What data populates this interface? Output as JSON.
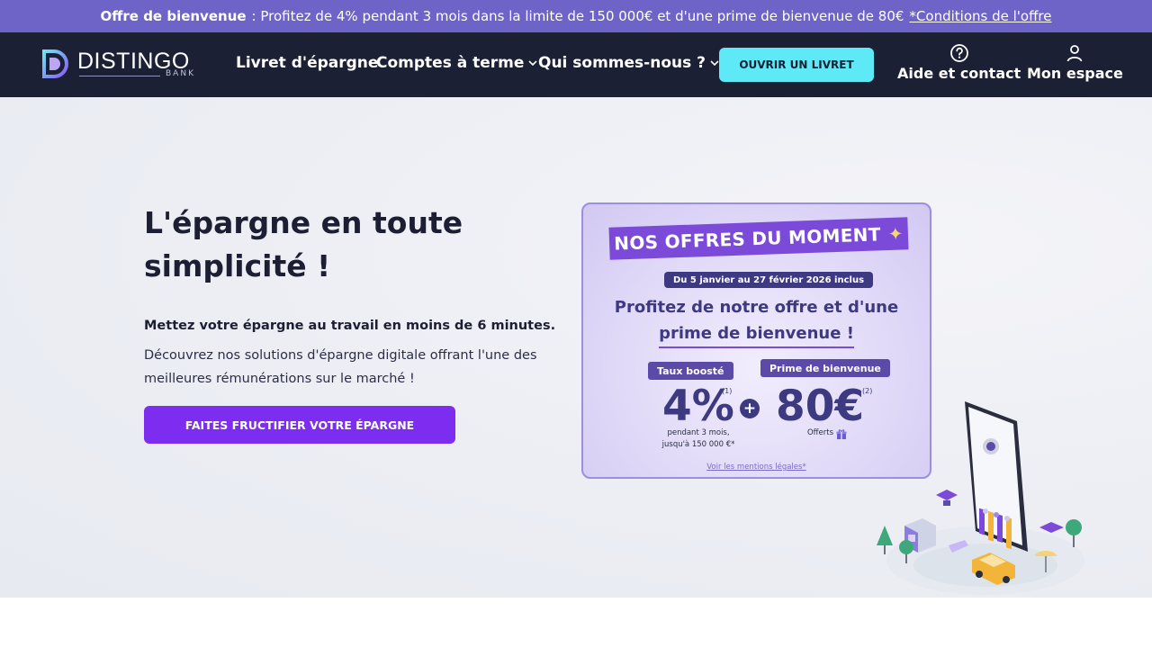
{
  "topbar": {
    "prefix": "Offre de bienvenue",
    "text": ": Profitez de 4% pendant 3 mois dans la limite de 150 000€ et d'une prime de bienvenue de 80€",
    "link": "*Conditions de l'offre"
  },
  "logo": {
    "name": "DISTINGO",
    "sub": "BANK"
  },
  "nav": {
    "items": [
      {
        "label": "Livret d'épargne"
      },
      {
        "label": "Comptes à terme"
      },
      {
        "label": "Qui sommes-nous ?"
      }
    ],
    "cta": "OUVRIR UN LIVRET",
    "help": "Aide et contact",
    "account": "Mon espace"
  },
  "hero": {
    "title": "L'épargne en toute simplicité !",
    "lead": "Mettez votre épargne au travail en moins de 6 minutes.",
    "description": "Découvrez nos solutions d'épargne digitale offrant l'une des meilleures rémunérations sur le marché !",
    "cta": "FAITES FRUCTIFIER VOTRE ÉPARGNE"
  },
  "offer": {
    "banner": "NOS OFFRES DU MOMENT",
    "dates": "Du 5 janvier au 27 février 2026 inclus",
    "headline_1": "Profitez de notre offre et d'une",
    "headline_2": "prime de bienvenue !",
    "rate_tag": "Taux boosté",
    "rate_value": "4%",
    "rate_note_ref": "(1)",
    "rate_caption_1": "pendant 3 mois,",
    "rate_caption_2": "jusqu'à 150 000 €*",
    "bonus_tag": "Prime de bienvenue",
    "bonus_value": "80€",
    "bonus_note_ref": "(2)",
    "bonus_caption": "Offerts",
    "legal": "Voir les mentions légales*"
  },
  "colors": {
    "topbar": "#6e63c7",
    "nav": "#1c2035",
    "cta_cyan": "#5de9f6",
    "cta_purple": "#7d2df0",
    "offer_navy": "#3d3a82"
  }
}
